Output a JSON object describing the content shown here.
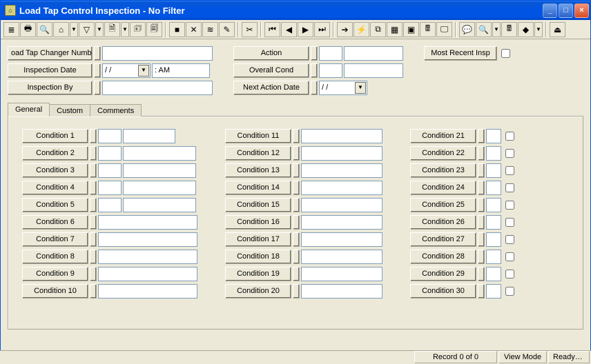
{
  "window": {
    "title": "Load Tap Control Inspection - No Filter",
    "min_label": "_",
    "max_label": "□",
    "close_label": "×",
    "appicon_text": "⌂"
  },
  "toolbar": {
    "icons": [
      "≣",
      "🖶",
      "🔍",
      "⌂",
      "▾",
      "▽",
      "▾",
      "🗎",
      "▾",
      "🗊",
      "🗐",
      "",
      "■",
      "✕",
      "≋",
      "✎",
      "",
      "✂",
      "",
      "⏮",
      "◀",
      "▶",
      "⏭",
      "",
      "➔",
      "⚡",
      "⧉",
      "▦",
      "▣",
      "🖩",
      "🖵",
      "",
      "💬",
      "🔍",
      "▾",
      "🖩",
      "◆",
      "▾",
      "",
      "⏏"
    ]
  },
  "header": {
    "ltcn_label": "oad Tap Changer Numbe",
    "inspection_date_label": "Inspection Date",
    "inspection_date_value": "  /  /",
    "inspection_date_time": " :    AM",
    "inspection_by_label": "Inspection By",
    "action_label": "Action",
    "overall_cond_label": "Overall Cond",
    "next_action_date_label": "Next Action Date",
    "next_action_date_value": "  /  /",
    "most_recent_insp_label": "Most Recent Insp"
  },
  "tabs": {
    "general": "General",
    "custom": "Custom",
    "comments": "Comments"
  },
  "conditions": {
    "col1": [
      "Condition 1",
      "Condition 2",
      "Condition 3",
      "Condition 4",
      "Condition 5",
      "Condition 6",
      "Condition 7",
      "Condition 8",
      "Condition 9",
      "Condition 10"
    ],
    "col2": [
      "Condition 11",
      "Condition 12",
      "Condition 13",
      "Condition 14",
      "Condition 15",
      "Condition 16",
      "Condition 17",
      "Condition 18",
      "Condition 19",
      "Condition 20"
    ],
    "col3": [
      "Condition 21",
      "Condition 22",
      "Condition 23",
      "Condition 24",
      "Condition 25",
      "Condition 26",
      "Condition 27",
      "Condition 28",
      "Condition 29",
      "Condition 30"
    ]
  },
  "status": {
    "record": "Record 0 of 0",
    "view_mode": "View Mode",
    "ready": "Ready…"
  }
}
